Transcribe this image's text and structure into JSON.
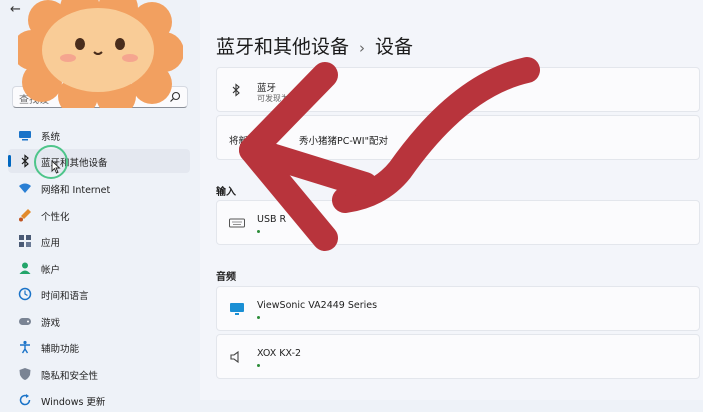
{
  "window": {
    "title": "设",
    "back_glyph": "←"
  },
  "search": {
    "placeholder": "查找设"
  },
  "sidebar": {
    "items": [
      {
        "label": "系统",
        "icon": "system-icon"
      },
      {
        "label": "蓝牙和其他设备",
        "icon": "bluetooth-icon",
        "active": true
      },
      {
        "label": "网络和 Internet",
        "icon": "network-icon"
      },
      {
        "label": "个性化",
        "icon": "brush-icon"
      },
      {
        "label": "应用",
        "icon": "apps-icon"
      },
      {
        "label": "帐户",
        "icon": "account-icon"
      },
      {
        "label": "时间和语言",
        "icon": "time-language-icon"
      },
      {
        "label": "游戏",
        "icon": "game-icon"
      },
      {
        "label": "辅助功能",
        "icon": "accessibility-icon"
      },
      {
        "label": "隐私和安全性",
        "icon": "shield-icon"
      },
      {
        "label": "Windows 更新",
        "icon": "update-icon"
      }
    ]
  },
  "breadcrumb": {
    "parent": "蓝牙和其他设备",
    "separator": "›",
    "current": "设备"
  },
  "bluetooth_card": {
    "title": "蓝牙",
    "subtitle": "可发现为\"PC-WI\""
  },
  "pair_card": {
    "text_start": "将新",
    "text_end": "秀小猪猪PC-WI\"配对"
  },
  "input_section": {
    "heading": "输入",
    "device": "USB R"
  },
  "audio_section": {
    "heading": "音频",
    "devices": [
      {
        "name": "ViewSonic VA2449 Series"
      },
      {
        "name": "XOX KX-2"
      }
    ]
  },
  "colors": {
    "accent": "#0067c0",
    "arrow": "#b8343c",
    "ring": "#4ec58a",
    "sticker": "#f7b07a"
  }
}
